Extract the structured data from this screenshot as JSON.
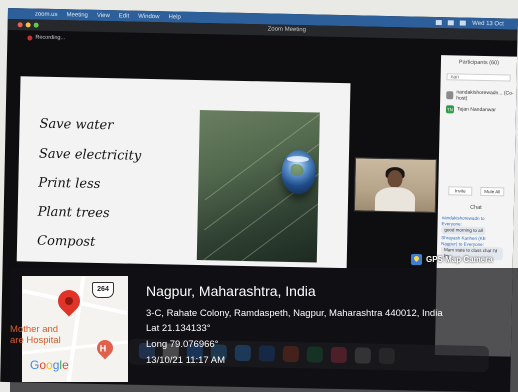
{
  "menubar": {
    "app": "zoom.us",
    "items": [
      "Meeting",
      "View",
      "Edit",
      "Window",
      "Help"
    ],
    "clock": "Wed 13 Oct"
  },
  "window": {
    "title": "Zoom Meeting",
    "recording": "Recording..."
  },
  "slide": {
    "items": [
      "Save water",
      "Save electricity",
      "Print less",
      "Plant trees",
      "Compost"
    ]
  },
  "sidebar": {
    "participants_header": "Participants (60)",
    "search_value": "nan",
    "participants": [
      {
        "initial": "",
        "name": "nandakishorewadn... (Co-host)",
        "color": "#8a8a8a"
      },
      {
        "initial": "TN",
        "name": "Tejan Nandanwar",
        "color": "#2e9a4a"
      }
    ],
    "buttons": [
      "Invite",
      "Mute All"
    ],
    "chat_header": "Chat",
    "messages": [
      {
        "who": "nandakishorewadn to Everyone:",
        "text": "good morning to all"
      },
      {
        "who": "Shrayash Kanheri (KE Nagpur) to Everyone:",
        "text": "Mam state to class chat I'd be"
      }
    ]
  },
  "gps": {
    "badge": "GPS Map Camera",
    "city": "Nagpur, Maharashtra, India",
    "address": "3-C, Rahate Colony, Ramdaspeth, Nagpur, Maharashtra 440012, India",
    "lat": "Lat 21.134133°",
    "long": "Long 79.076966°",
    "datetime": "13/10/21 11:17 AM",
    "map": {
      "route_shield": "264",
      "poi_line1": "Mother and",
      "poi_line2": "are Hospital",
      "poi_icon": "H",
      "logo": "Google"
    }
  }
}
